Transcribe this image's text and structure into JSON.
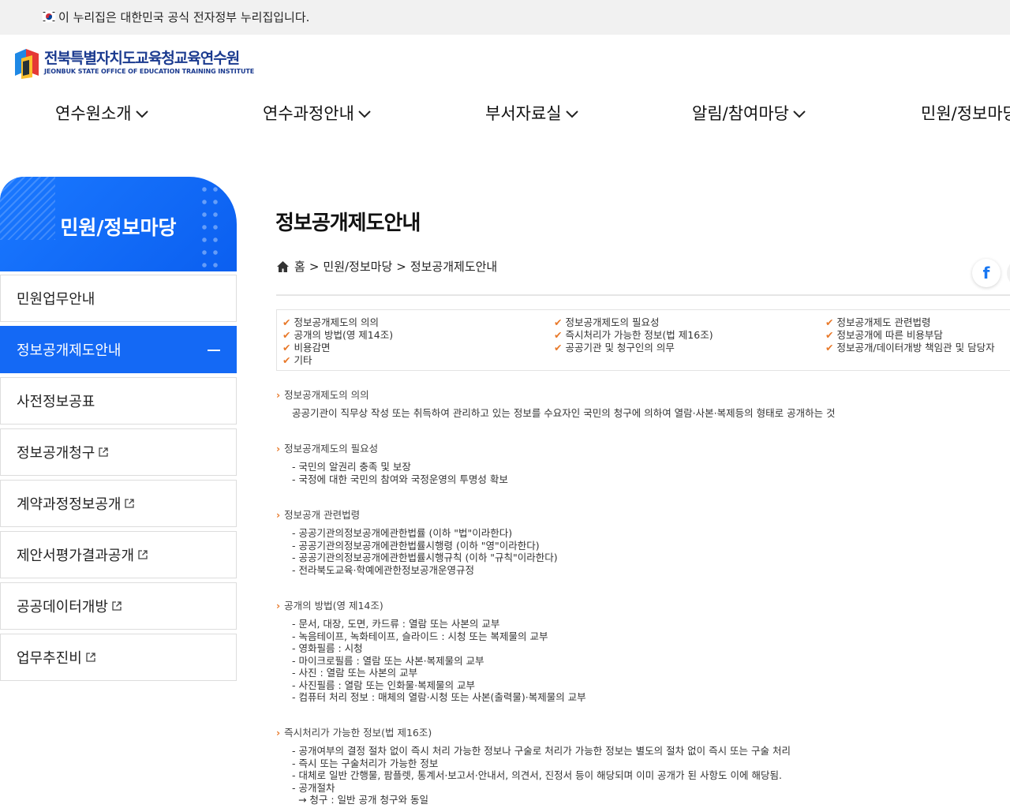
{
  "gov_banner": {
    "text": "이 누리집은 대한민국 공식 전자정부 누리집입니다."
  },
  "logo": {
    "name_ko": "전북특별자치도교육청교육연수원",
    "name_en": "JEONBUK STATE OFFICE OF EDUCATION TRAINING INSTITUTE"
  },
  "gnb": {
    "items": [
      "연수원소개",
      "연수과정안내",
      "부서자료실",
      "알림/참여마당",
      "민원/정보마당"
    ]
  },
  "lnb": {
    "title": "민원/정보마당",
    "items": [
      {
        "label": "민원업무안내"
      },
      {
        "label": "정보공개제도안내"
      },
      {
        "label": "사전정보공표"
      },
      {
        "label": "정보공개청구"
      },
      {
        "label": "계약과정정보공개"
      },
      {
        "label": "제안서평가결과공개"
      },
      {
        "label": "공공데이터개방"
      },
      {
        "label": "업무추진비"
      }
    ]
  },
  "page": {
    "title": "정보공개제도안내",
    "breadcrumb": [
      "홈",
      "민원/정보마당",
      "정보공개제도안내"
    ],
    "breadcrumb_sep": ">",
    "share_icon": "facebook-icon"
  },
  "toc": {
    "columns": [
      [
        "정보공개제도의 의의",
        "공개의 방법(영 제14조)",
        "비용감면",
        "기타"
      ],
      [
        "정보공개제도의 필요성",
        "즉시처리가 가능한 정보(법 제16조)",
        "공공기관 및 청구인의 의무"
      ],
      [
        "정보공개제도 관련법령",
        "정보공개에 따른 비용부담",
        "정보공개/데이터개방 책임관 및 담당자"
      ]
    ]
  },
  "sections": [
    {
      "heading": "정보공개제도의 의의",
      "paragraph": "공공기관이 직무상 작성 또는 취득하여 관리하고 있는 정보를 수요자인 국민의 청구에 의하여 열람·사본·복제등의 형태로 공개하는 것"
    },
    {
      "heading": "정보공개제도의 필요성",
      "items": [
        "- 국민의 알권리 충족 및 보장",
        "- 국정에 대한 국민의 참여와 국정운영의 투명성 확보"
      ]
    },
    {
      "heading": "정보공개 관련법령",
      "items": [
        "- 공공기관의정보공개에관한법률 (이하 \"법\"이라한다)",
        "- 공공기관의정보공개에관한법률시행령 (이하 \"영\"이라한다)",
        "- 공공기관의정보공개에관한법률시행규칙 (이하 \"규칙\"이라한다)",
        "- 전라북도교육·학예에관한정보공개운영규정"
      ]
    },
    {
      "heading": "공개의 방법(영 제14조)",
      "items": [
        "- 문서, 대장, 도면, 카드류 : 열람 또는 사본의 교부",
        "- 녹음테이프, 녹화테이프, 슬라이드 : 시청 또는 복제물의 교부",
        "- 영화필름 : 시청",
        "- 마이크로필름 : 열람 또는 사본·복제물의 교부",
        "- 사진 : 열람 또는 사본의 교부",
        "- 사진필름 : 열람 또는 인화물·복제물의 교부",
        "- 컴퓨터 처리 정보 : 매체의 열람·시청 또는 사본(출력물)·복제물의 교부"
      ]
    },
    {
      "heading": "즉시처리가 가능한 정보(법 제16조)",
      "items": [
        "- 공개여부의 결정 절차 없이 즉시 처리 가능한 정보나 구술로 처리가 가능한 정보는 별도의 절차 없이 즉시 또는 구술 처리",
        "- 즉시 또는 구술처리가 가능한 정보",
        "- 대체로 일반 간행물, 팜플렛, 통계서·보고서·안내서, 의견서, 진정서 등이 해당되며 이미 공개가 된 사항도 이에 해당됨.",
        "- 공개절차",
        "  → 청구 : 일반 공개 청구와 동일"
      ]
    }
  ],
  "colors": {
    "primary": "#1469f5",
    "accent": "#e8792a",
    "logo": "#1a3a8f"
  }
}
